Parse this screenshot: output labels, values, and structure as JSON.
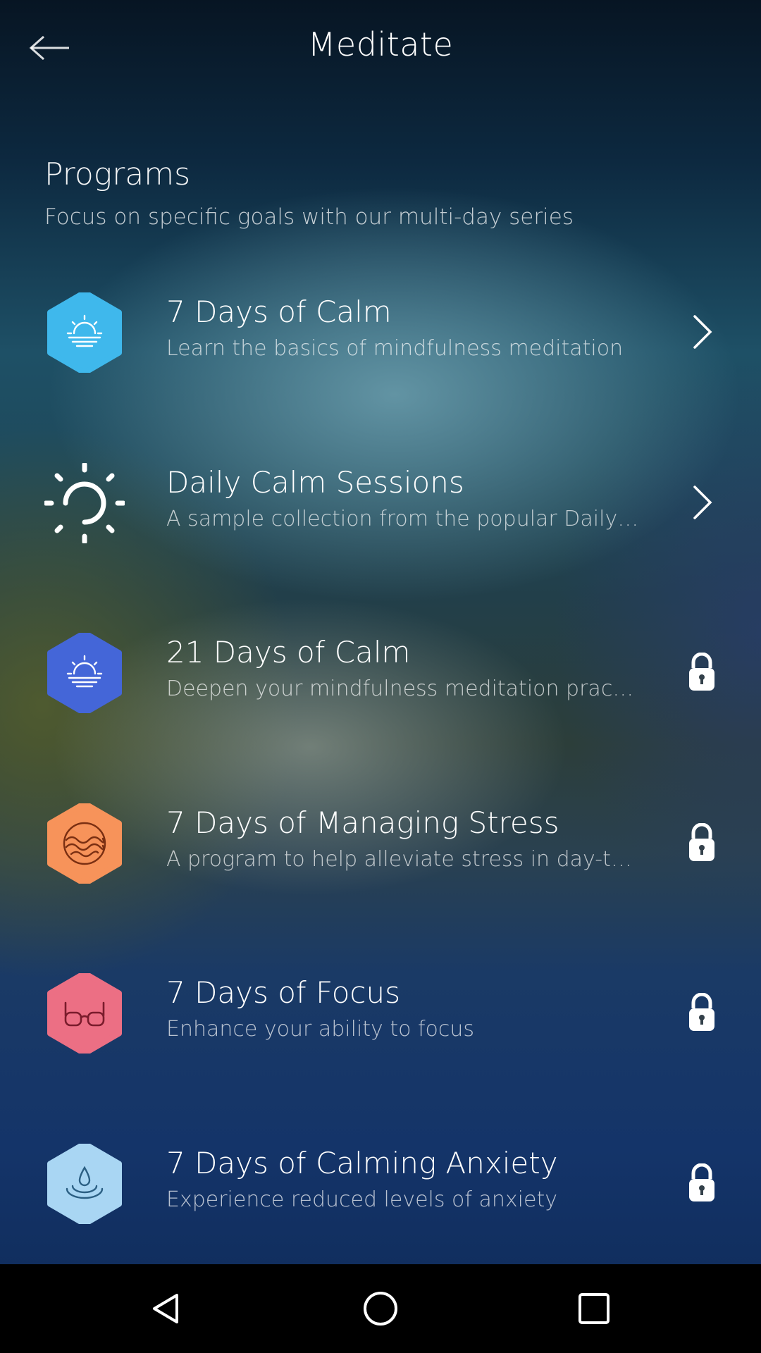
{
  "header": {
    "title": "Meditate",
    "back_icon": "arrow-left-icon"
  },
  "section": {
    "title": "Programs",
    "subtitle": "Focus on specific goals with our multi-day series"
  },
  "programs": [
    {
      "title": "7 Days of Calm",
      "subtitle": "Learn the basics of mindfulness meditation",
      "icon": "sunrise-icon",
      "icon_shape": "hexagon",
      "icon_color": "#3fb8ec",
      "trailing": "chevron-right-icon",
      "locked": false
    },
    {
      "title": "Daily Calm Sessions",
      "subtitle": "A sample collection from the popular Daily…",
      "icon": "sun-icon",
      "icon_shape": "none",
      "icon_color": "#ffffff",
      "trailing": "chevron-right-icon",
      "locked": false
    },
    {
      "title": "21 Days of Calm",
      "subtitle": "Deepen your mindfulness meditation prac…",
      "icon": "sunrise-icon",
      "icon_shape": "hexagon",
      "icon_color": "#4466d8",
      "trailing": "lock-icon",
      "locked": true
    },
    {
      "title": "7 Days of Managing Stress",
      "subtitle": "A program to help alleviate stress in day-t…",
      "icon": "waves-icon",
      "icon_shape": "hexagon",
      "icon_color": "#f7935a",
      "trailing": "lock-icon",
      "locked": true
    },
    {
      "title": "7 Days of Focus",
      "subtitle": "Enhance your ability to focus",
      "icon": "glasses-icon",
      "icon_shape": "hexagon",
      "icon_color": "#ec6f84",
      "trailing": "lock-icon",
      "locked": true
    },
    {
      "title": "7 Days of Calming Anxiety",
      "subtitle": "Experience reduced levels of anxiety",
      "icon": "water-drop-icon",
      "icon_shape": "hexagon",
      "icon_color": "#a9d6f3",
      "trailing": "lock-icon",
      "locked": true
    }
  ],
  "navbar": {
    "back_icon": "nav-back-triangle-icon",
    "home_icon": "nav-home-circle-icon",
    "recents_icon": "nav-recents-square-icon"
  }
}
